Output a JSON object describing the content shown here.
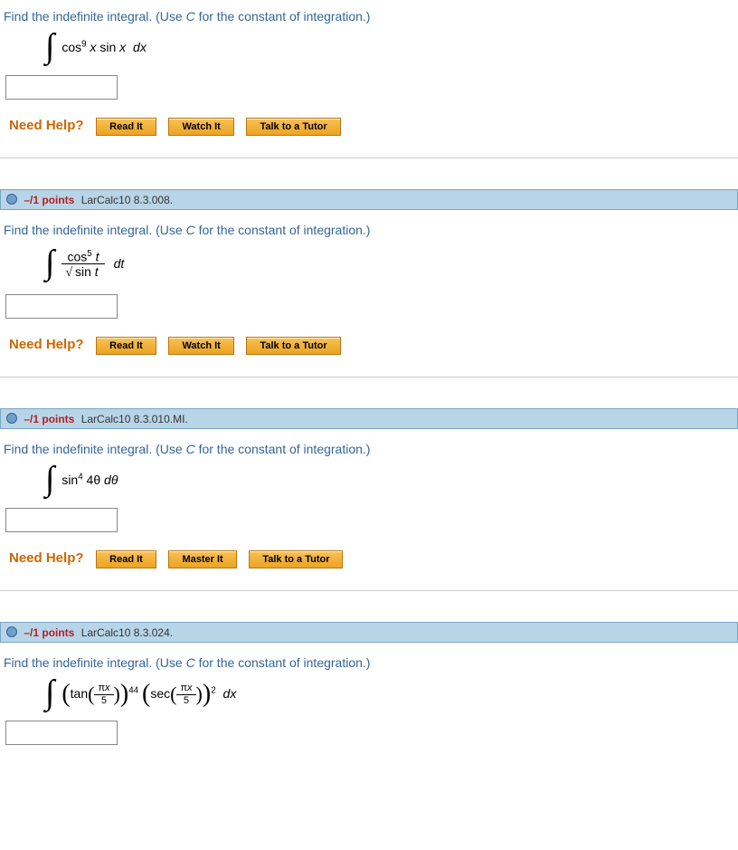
{
  "shared": {
    "prompt_text_a": "Find the indefinite integral. (Use ",
    "prompt_text_b": " for the constant of integration.)",
    "need_help": "Need Help?",
    "btn_read": "Read It",
    "btn_watch": "Watch It",
    "btn_master": "Master It",
    "btn_tutor": "Talk to a Tutor"
  },
  "q1": {
    "formula": {
      "integrand_a": "cos",
      "exp_a": "9",
      "var1": "x",
      "mid": " sin ",
      "var2": "x",
      "dx": "dx"
    }
  },
  "q2": {
    "points": "–/1 points",
    "ref": "LarCalc10 8.3.008.",
    "formula": {
      "num_a": "cos",
      "num_exp": "5",
      "num_var": "t",
      "den_rad": "sin ",
      "den_var": "t",
      "dt": "dt"
    }
  },
  "q3": {
    "points": "–/1 points",
    "ref": "LarCalc10 8.3.010.MI.",
    "formula": {
      "a": "sin",
      "exp": "4",
      "arg": " 4θ ",
      "dθ": "dθ"
    }
  },
  "q4": {
    "points": "–/1 points",
    "ref": "LarCalc10 8.3.024.",
    "formula": {
      "tan": "tan",
      "sec": "sec",
      "pi": "π",
      "x": "x",
      "five": "5",
      "exp1": "44",
      "exp2": "2",
      "dx": "dx"
    }
  }
}
